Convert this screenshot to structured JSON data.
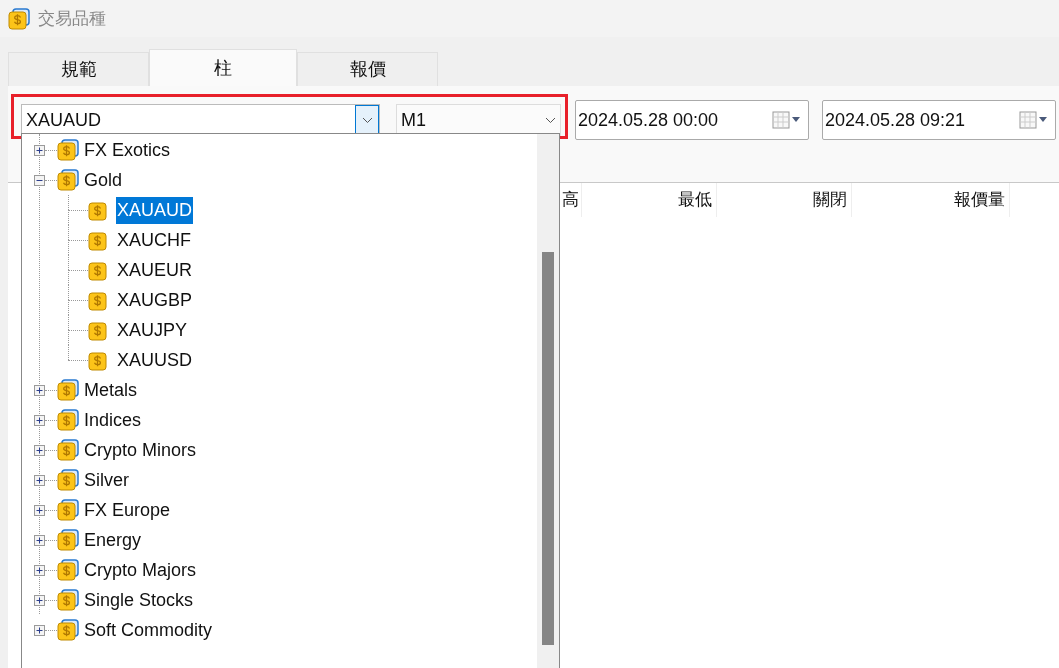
{
  "window": {
    "title": "交易品種"
  },
  "tabs": [
    {
      "label": "規範",
      "selected": false
    },
    {
      "label": "柱",
      "selected": true
    },
    {
      "label": "報價",
      "selected": false
    }
  ],
  "symbol_select": {
    "value": "XAUAUD",
    "open": true
  },
  "timeframe_select": {
    "value": "M1"
  },
  "date_from": {
    "value": "2024.05.28 00:00"
  },
  "date_to": {
    "value": "2024.05.28 09:21"
  },
  "table": {
    "columns": [
      "高",
      "最低",
      "關閉",
      "報價量"
    ]
  },
  "tree": [
    {
      "label": "FX Exotics",
      "expanded": false
    },
    {
      "label": "Gold",
      "expanded": true,
      "children": [
        {
          "label": "XAUAUD",
          "selected": true
        },
        {
          "label": "XAUCHF",
          "selected": false
        },
        {
          "label": "XAUEUR",
          "selected": false
        },
        {
          "label": "XAUGBP",
          "selected": false
        },
        {
          "label": "XAUJPY",
          "selected": false
        },
        {
          "label": "XAUUSD",
          "selected": false
        }
      ]
    },
    {
      "label": "Metals",
      "expanded": false
    },
    {
      "label": "Indices",
      "expanded": false
    },
    {
      "label": "Crypto Minors",
      "expanded": false
    },
    {
      "label": "Silver",
      "expanded": false
    },
    {
      "label": "FX Europe",
      "expanded": false
    },
    {
      "label": "Energy",
      "expanded": false
    },
    {
      "label": "Crypto Majors",
      "expanded": false
    },
    {
      "label": "Single Stocks",
      "expanded": false
    },
    {
      "label": "Soft Commodity",
      "expanded": false
    }
  ]
}
